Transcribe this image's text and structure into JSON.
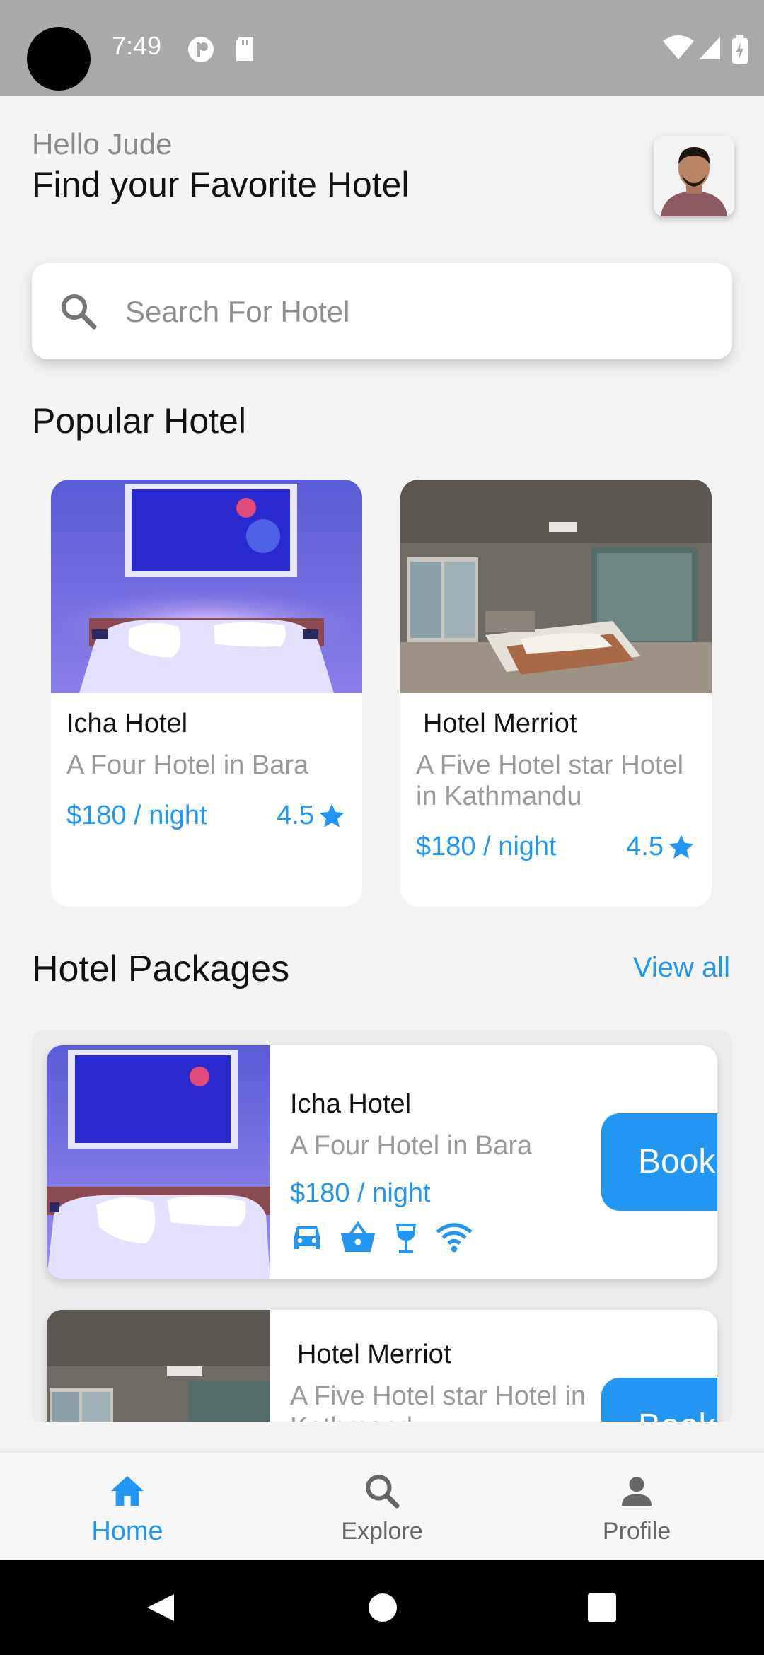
{
  "status_bar": {
    "time": "7:49"
  },
  "header": {
    "greeting": "Hello Jude",
    "title": "Find your Favorite Hotel"
  },
  "search": {
    "placeholder": "Search For Hotel"
  },
  "popular": {
    "title": "Popular Hotel",
    "cards": [
      {
        "name": "Icha Hotel",
        "desc": "A Four Hotel in Bara",
        "price": "$180 / night",
        "rating": "4.5"
      },
      {
        "name": "Hotel Merriot",
        "desc": "A Five Hotel star Hotel in Kathmandu",
        "price": "$180 / night",
        "rating": "4.5"
      }
    ]
  },
  "packages": {
    "title": "Hotel Packages",
    "view_all": "View all",
    "items": [
      {
        "name": "Icha Hotel",
        "desc": "A Four Hotel in Bara",
        "price": "$180 / night",
        "book_label": "Book"
      },
      {
        "name": "Hotel Merriot",
        "desc": "A Five Hotel star Hotel in Kathmandu",
        "book_label": "Book"
      }
    ],
    "amenities": [
      "car-icon",
      "basket-icon",
      "wine-glass-icon",
      "wifi-icon"
    ]
  },
  "bottom_nav": {
    "items": [
      {
        "label": "Home",
        "icon": "home-icon",
        "active": true
      },
      {
        "label": "Explore",
        "icon": "search-icon",
        "active": false
      },
      {
        "label": "Profile",
        "icon": "person-icon",
        "active": false
      }
    ]
  },
  "colors": {
    "accent": "#2196f3",
    "status_bar": "#a9a9a9",
    "background": "#f4f4f4"
  }
}
